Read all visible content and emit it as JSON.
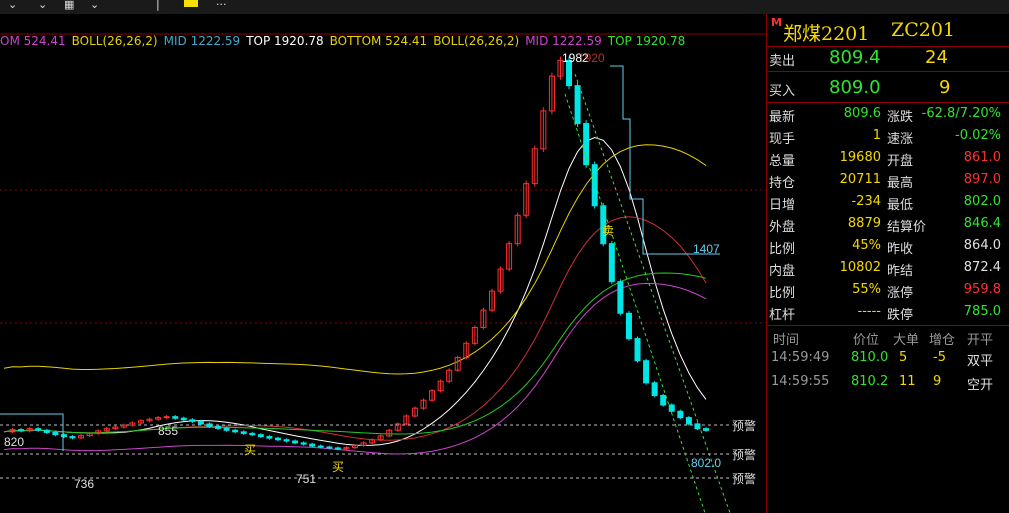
{
  "toolbar": {
    "right_items": [
      "...",
      "...",
      "...",
      "...",
      "...",
      "...",
      "..."
    ]
  },
  "indicators": [
    {
      "text": "OM 524.41",
      "color": "#cc44cc"
    },
    {
      "text": "BOLL(26,26,2)",
      "color": "#e6d200"
    },
    {
      "text": "MID 1222.59",
      "color": "#44aacc"
    },
    {
      "text": "TOP 1920.78",
      "color": "#ffffff"
    },
    {
      "text": "BOTTOM 524.41",
      "color": "#e6d200"
    },
    {
      "text": "BOLL(26,26,2)",
      "color": "#e6d200"
    },
    {
      "text": "MID 1222.59",
      "color": "#cc44cc"
    },
    {
      "text": "TOP 1920.78",
      "color": "#2ee52e"
    }
  ],
  "chart_labels": {
    "high": "1982",
    "high_ghost": "1920",
    "level_1407": "1407",
    "p855": "855",
    "p820": "820",
    "p736": "736",
    "p751": "751",
    "last_price": "802.0",
    "sell_marker": "卖",
    "buy_marker": "买",
    "warn1": "预警",
    "warn2": "预警",
    "warn3": "预警"
  },
  "chart_data": {
    "type": "candlestick",
    "ylim": [
      640,
      2000
    ],
    "high": 1982,
    "last": 802.0,
    "horizontal_levels": [
      1407
    ],
    "annotations": [
      "1982",
      "855",
      "820",
      "736",
      "751",
      "802.0",
      "1407"
    ],
    "closes": [
      805,
      812,
      808,
      815,
      810,
      803,
      796,
      790,
      786,
      793,
      800,
      808,
      815,
      820,
      826,
      833,
      840,
      845,
      850,
      853,
      848,
      843,
      838,
      830,
      822,
      816,
      810,
      805,
      800,
      796,
      790,
      785,
      780,
      776,
      770,
      766,
      760,
      757,
      754,
      751,
      755,
      762,
      770,
      780,
      792,
      810,
      830,
      855,
      880,
      905,
      935,
      965,
      1000,
      1040,
      1085,
      1135,
      1190,
      1250,
      1320,
      1400,
      1490,
      1590,
      1700,
      1820,
      1930,
      1980,
      1900,
      1780,
      1650,
      1520,
      1400,
      1280,
      1180,
      1100,
      1030,
      960,
      920,
      890,
      870,
      850,
      830,
      815,
      809.6
    ]
  },
  "quote": {
    "flag": "M",
    "title": "郑煤2201",
    "code": "ZC201",
    "sell": {
      "label": "卖出",
      "price": "809.4",
      "vol": "24"
    },
    "buy": {
      "label": "买入",
      "price": "809.0",
      "vol": "9"
    },
    "rows": [
      {
        "l1": "最新",
        "v1": "809.6",
        "c1": "green",
        "l2": "涨跌",
        "v2": "-62.8/7.20%",
        "c2": "green"
      },
      {
        "l1": "现手",
        "v1": "1",
        "c1": "yellow",
        "l2": "速涨",
        "v2": "-0.02%",
        "c2": "green"
      },
      {
        "l1": "总量",
        "v1": "19680",
        "c1": "yellow",
        "l2": "开盘",
        "v2": "861.0",
        "c2": "red"
      },
      {
        "l1": "持仓",
        "v1": "20711",
        "c1": "yellow",
        "l2": "最高",
        "v2": "897.0",
        "c2": "red"
      },
      {
        "l1": "日增",
        "v1": "-234",
        "c1": "yellow",
        "l2": "最低",
        "v2": "802.0",
        "c2": "green"
      },
      {
        "l1": "外盘",
        "v1": "8879",
        "c1": "yellow",
        "l2": "结算价",
        "v2": "846.4",
        "c2": "green"
      },
      {
        "l1": "比例",
        "v1": "45%",
        "c1": "yellow",
        "l2": "昨收",
        "v2": "864.0",
        "c2": "white"
      },
      {
        "l1": "内盘",
        "v1": "10802",
        "c1": "yellow",
        "l2": "昨结",
        "v2": "872.4",
        "c2": "white"
      },
      {
        "l1": "比例",
        "v1": "55%",
        "c1": "yellow",
        "l2": "涨停",
        "v2": "959.8",
        "c2": "red"
      },
      {
        "l1": "杠杆",
        "v1": "-----",
        "c1": "yellow",
        "l2": "跌停",
        "v2": "785.0",
        "c2": "green"
      }
    ],
    "ticks_header": {
      "time": "时间",
      "price": "价位",
      "big": "大单",
      "inc": "增仓",
      "type": "开平"
    },
    "ticks": [
      {
        "time": "14:59:49",
        "price": "810.0",
        "big": "5",
        "inc": "-5",
        "type": "双平"
      },
      {
        "time": "14:59:55",
        "price": "810.2",
        "big": "11",
        "inc": "9",
        "type": "空开"
      }
    ]
  }
}
